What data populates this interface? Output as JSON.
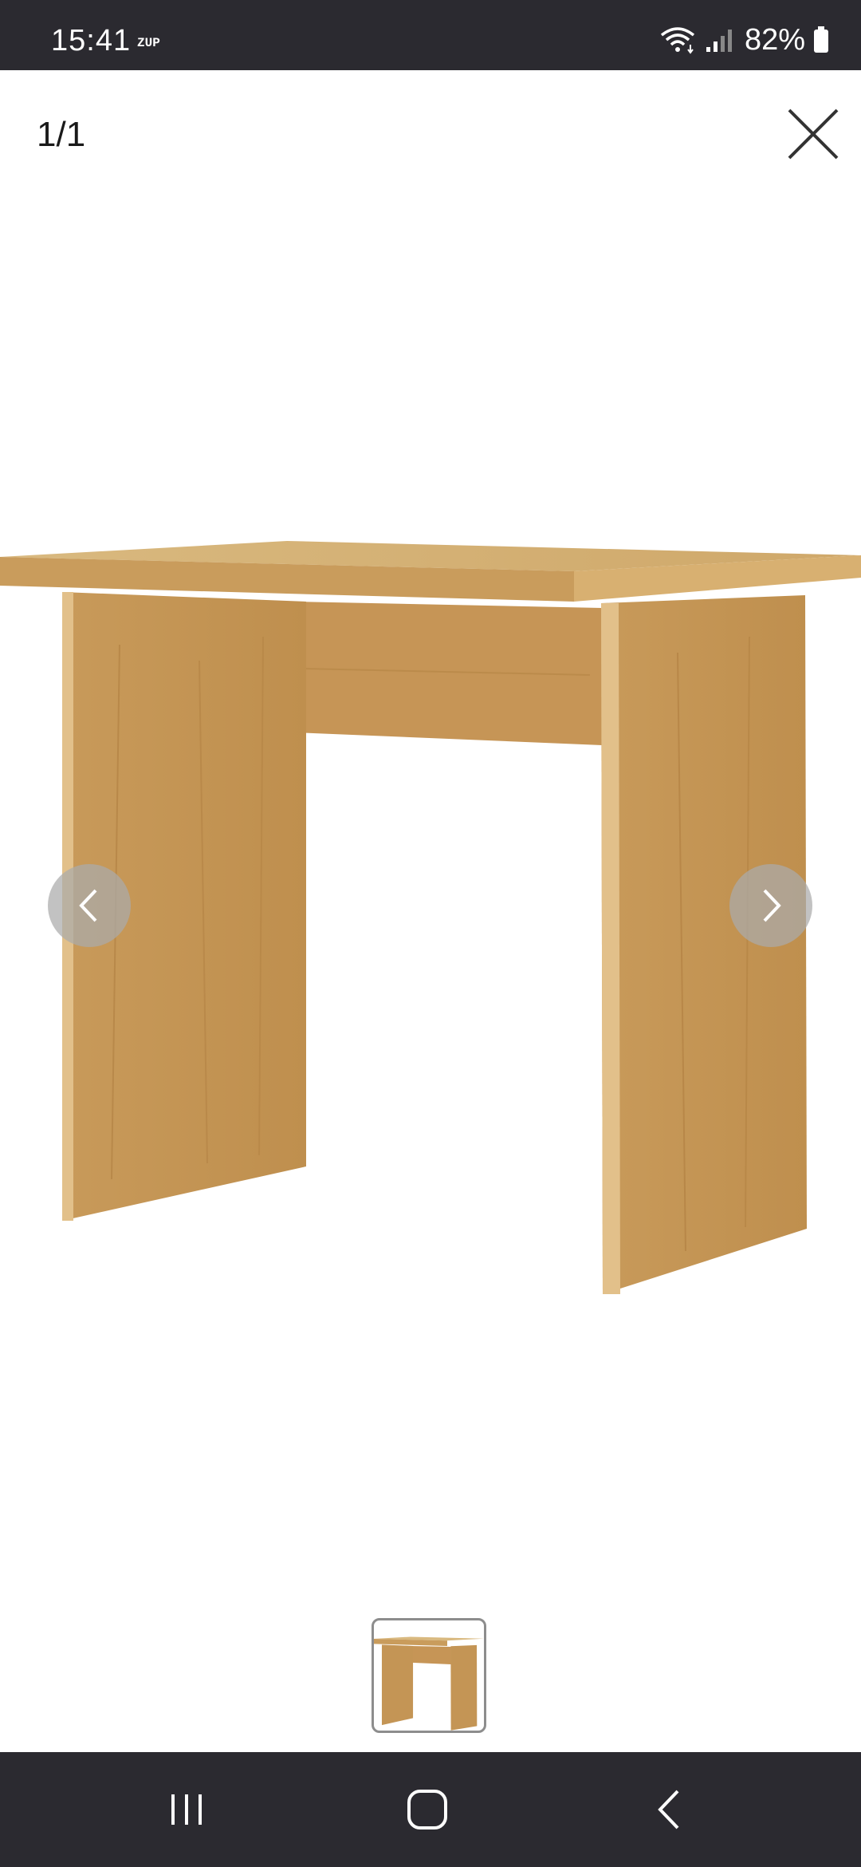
{
  "status_bar": {
    "time": "15:41",
    "app_indicator": "ZUP",
    "battery": "82%",
    "icons": [
      "wifi-icon",
      "signal-icon",
      "battery-icon"
    ]
  },
  "viewer": {
    "counter": "1/1",
    "close_icon": "close-icon",
    "prev_icon": "chevron-left-icon",
    "next_icon": "chevron-right-icon"
  },
  "product_image": {
    "subject": "oak-finish desk",
    "colors": {
      "wood_light": "#d8b57a",
      "wood_mid": "#c79a5b",
      "wood_dark": "#b0803f"
    }
  },
  "thumbnails": [
    "desk-thumbnail"
  ],
  "system_nav": {
    "icons": [
      "recent-apps-icon",
      "home-icon",
      "back-icon"
    ]
  }
}
